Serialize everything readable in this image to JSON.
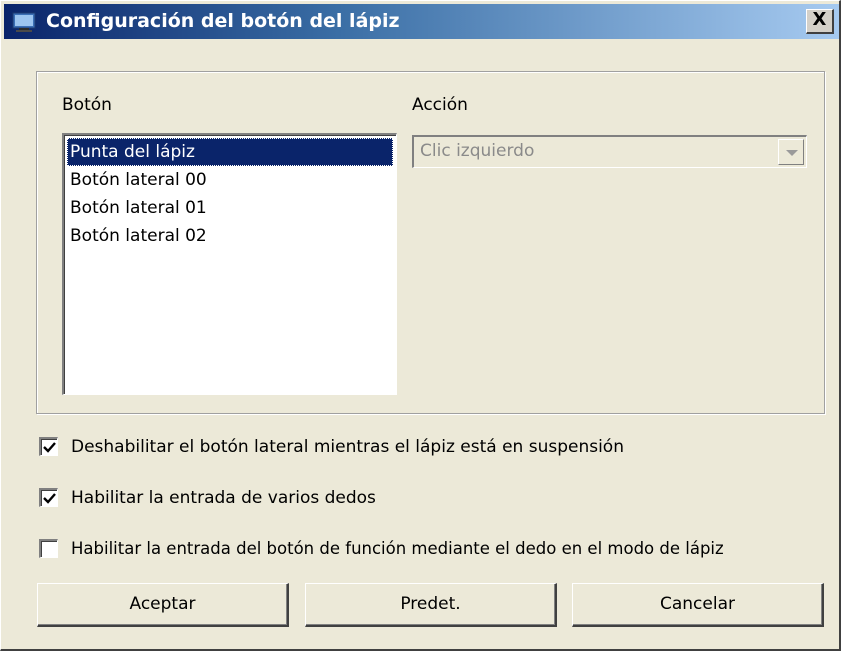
{
  "window": {
    "title": "Configuración del botón del lápiz",
    "close_label": "X"
  },
  "group": {
    "button_header": "Botón",
    "action_header": "Acción",
    "buttons": [
      {
        "label": "Punta del lápiz",
        "selected": true
      },
      {
        "label": "Botón lateral 00",
        "selected": false
      },
      {
        "label": "Botón lateral 01",
        "selected": false
      },
      {
        "label": "Botón lateral 02",
        "selected": false
      }
    ],
    "action_value": "Clic izquierdo"
  },
  "options": [
    {
      "label": "Deshabilitar el botón lateral mientras el lápiz está en suspensión",
      "checked": true
    },
    {
      "label": "Habilitar la entrada de varios dedos",
      "checked": true
    },
    {
      "label": "Habilitar la entrada del botón de función mediante el dedo en el modo de lápiz",
      "checked": false
    }
  ],
  "footer": {
    "ok_label": "Aceptar",
    "default_label": "Predet.",
    "cancel_label": "Cancelar"
  },
  "colors": {
    "title_start": "#0a246a",
    "title_end": "#a6caf0",
    "selection": "#0a246a",
    "face": "#ece9d8"
  }
}
